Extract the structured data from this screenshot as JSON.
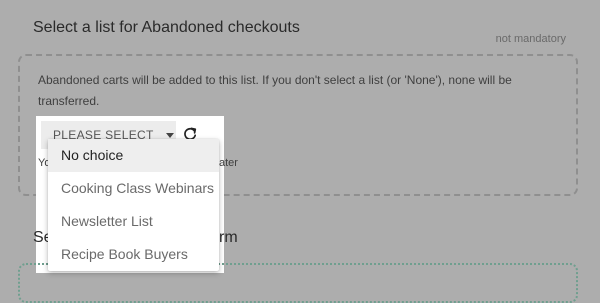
{
  "section": {
    "title": "Select a list for Abandoned checkouts",
    "not_mandatory": "not mandatory",
    "description": "Abandoned carts will be added to this list. If you don't select a list (or 'None'), none will be transferred."
  },
  "select": {
    "label": "PLEASE SELECT",
    "help_start": "Yo",
    "help_end": "ater"
  },
  "dropdown": {
    "options": [
      "No choice",
      "Cooking Class Webinars",
      "Newsletter List",
      "Recipe Book Buyers"
    ],
    "highlighted": "No choice"
  },
  "next_section": {
    "title_start": "Se",
    "title_end": "rm"
  },
  "icons": {
    "caret": "caret-down-icon",
    "refresh": "refresh-icon"
  },
  "colors": {
    "background": "#adadad",
    "dropdown": "#ffffff",
    "highlight": "#eeeeee"
  }
}
